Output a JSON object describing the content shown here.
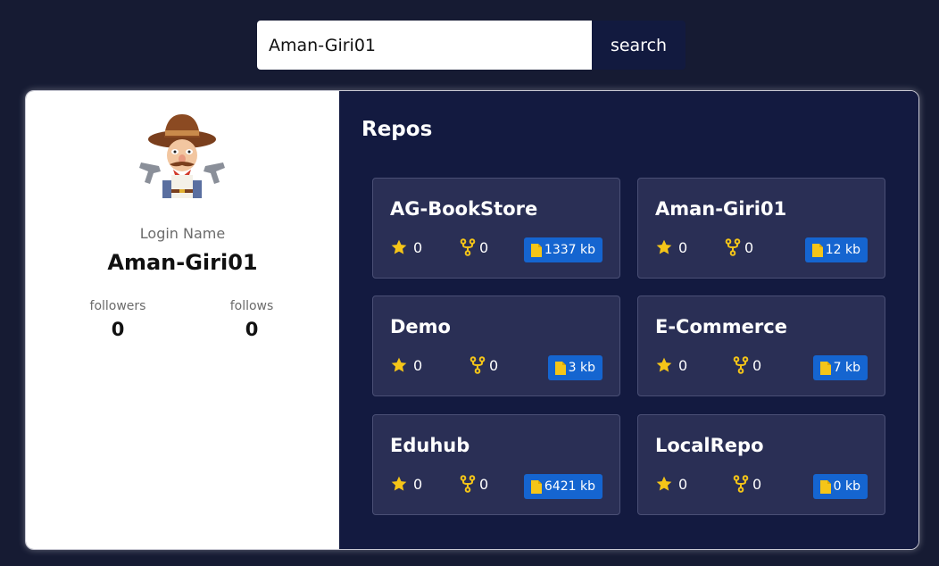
{
  "search": {
    "value": "Aman-Giri01",
    "button_label": "search"
  },
  "profile": {
    "login_label": "Login Name",
    "login_name": "Aman-Giri01",
    "followers_label": "followers",
    "followers_value": "0",
    "follows_label": "follows",
    "follows_value": "0"
  },
  "repos": {
    "title": "Repos",
    "items": [
      {
        "name": "AG-BookStore",
        "stars": "0",
        "forks": "0",
        "size": "1337 kb"
      },
      {
        "name": "Aman-Giri01",
        "stars": "0",
        "forks": "0",
        "size": "12 kb"
      },
      {
        "name": "Demo",
        "stars": "0",
        "forks": "0",
        "size": "3 kb"
      },
      {
        "name": "E-Commerce",
        "stars": "0",
        "forks": "0",
        "size": "7 kb"
      },
      {
        "name": "Eduhub",
        "stars": "0",
        "forks": "0",
        "size": "6421 kb"
      },
      {
        "name": "LocalRepo",
        "stars": "0",
        "forks": "0",
        "size": "0 kb"
      }
    ]
  },
  "icons": {
    "star": "star-icon",
    "fork": "fork-icon",
    "file": "file-icon"
  },
  "colors": {
    "background": "#161b33",
    "repos_panel": "#131a40",
    "repo_card": "#2a2f55",
    "size_badge": "#1565d0",
    "icon_yellow": "#f5c518"
  }
}
